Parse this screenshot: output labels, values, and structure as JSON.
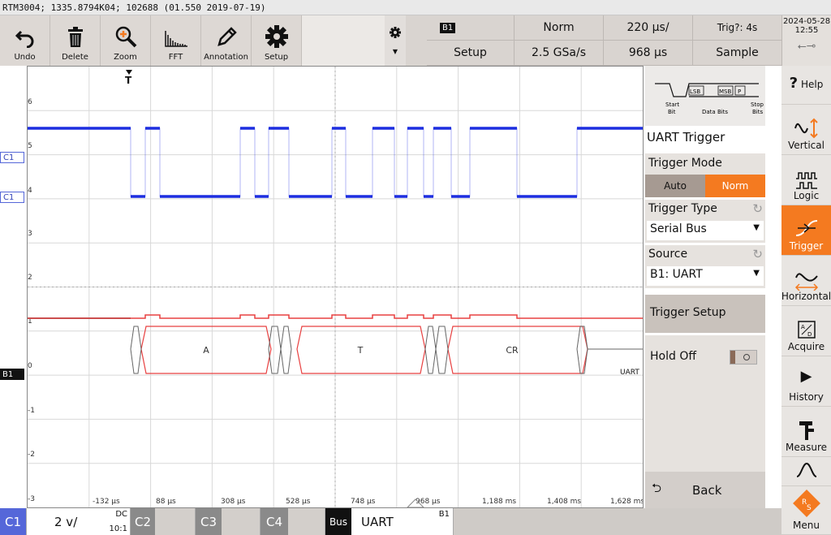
{
  "title": "RTM3004; 1335.8794K04; 102688 (01.550 2019-07-19)",
  "toolbar": {
    "undo": "Undo",
    "delete": "Delete",
    "zoom": "Zoom",
    "fft": "FFT",
    "annotation": "Annotation",
    "setup": "Setup"
  },
  "topinfo": {
    "bus": "B1",
    "setup": "Setup",
    "mode": "Norm",
    "timebase": "220 µs/",
    "trig": "Trig?: 4s",
    "samplerate": "2.5 GSa/s",
    "position": "968 µs",
    "acq": "Sample"
  },
  "clock": {
    "date": "2024-05-28",
    "time": "12:55"
  },
  "plot": {
    "y_ticks": [
      "6",
      "5",
      "4",
      "3",
      "2",
      "1",
      "0",
      "-1",
      "-2",
      "-3"
    ],
    "x_ticks": [
      "-132 µs",
      "88 µs",
      "308 µs",
      "528 µs",
      "748 µs",
      "968 µs",
      "1,188 ms",
      "1,408 ms",
      "1,628 ms"
    ],
    "trigger_marker": "T",
    "bus_labels": [
      "A",
      "T",
      "CR"
    ],
    "bus_name": "UART",
    "colors": {
      "c1": "#1d2ee0",
      "bus": "#e84040",
      "grid": "#d8d8d8"
    }
  },
  "channel_markers": {
    "c1a": "C1",
    "c1b": "C1",
    "b1": "B1"
  },
  "panel": {
    "diagram": {
      "start": "Start\nBit",
      "data": "Data Bits",
      "stop": "Stop\nBits",
      "lsb": "LSB",
      "msb": "MSB",
      "p": "P"
    },
    "title": "UART Trigger",
    "trigger_mode_label": "Trigger Mode",
    "auto": "Auto",
    "norm": "Norm",
    "trigger_type_label": "Trigger Type",
    "trigger_type_value": "Serial Bus",
    "source_label": "Source",
    "source_value": "B1: UART",
    "trigger_setup": "Trigger Setup",
    "hold_off": "Hold Off",
    "back": "Back"
  },
  "sidebar": {
    "help": "Help",
    "vertical": "Vertical",
    "logic": "Logic",
    "trigger": "Trigger",
    "horizontal": "Horizontal",
    "acquire": "Acquire",
    "history": "History",
    "measure": "Measure",
    "menu": "Menu"
  },
  "bottombar": {
    "c1": "C1",
    "c1scale": "2 v/",
    "coupling": "DC",
    "probe": "10:1",
    "c2": "C2",
    "c3": "C3",
    "c4": "C4",
    "bus": "Bus",
    "busname": "UART",
    "busid": "B1"
  },
  "accent": "#f47a20"
}
